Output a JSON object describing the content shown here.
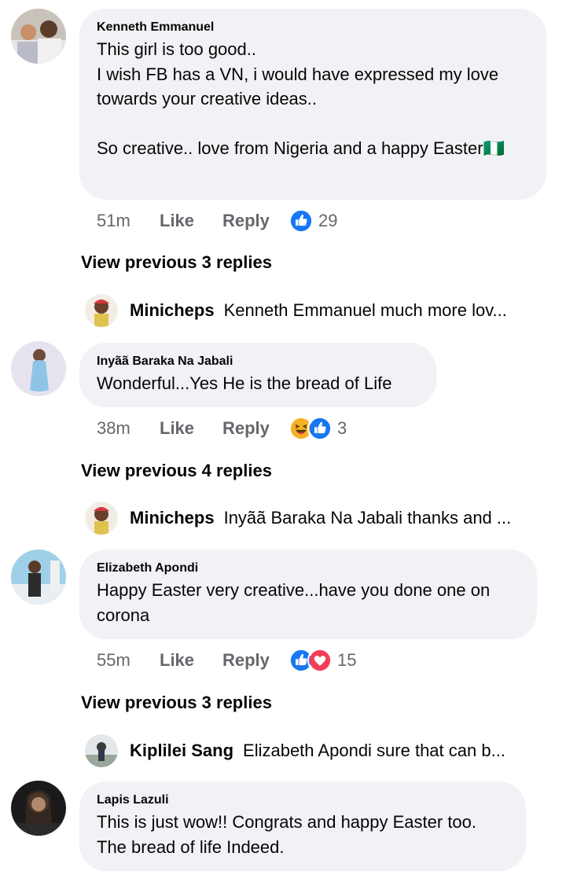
{
  "comments": [
    {
      "author": "Kenneth Emmanuel",
      "text": "This girl is too good..\nI wish FB has a VN, i would have expressed my love towards your creative ideas..\n\nSo creative.. love from Nigeria and a happy Easter🇳🇬",
      "time": "51m",
      "like_label": "Like",
      "reply_label": "Reply",
      "reactions": [
        "like-icon"
      ],
      "reaction_count": "29",
      "view_previous": "View previous 3 replies",
      "latest_reply": {
        "author": "Minicheps",
        "text": "Kenneth Emmanuel much more lov..."
      }
    },
    {
      "author": "Inyãã Baraka Na Jabali",
      "text": "Wonderful...Yes He is the bread of Life",
      "time": "38m",
      "like_label": "Like",
      "reply_label": "Reply",
      "reactions": [
        "haha-icon",
        "like-icon"
      ],
      "reaction_count": "3",
      "view_previous": "View previous 4 replies",
      "latest_reply": {
        "author": "Minicheps",
        "text": "Inyãã Baraka Na Jabali thanks and ..."
      }
    },
    {
      "author": "Elizabeth Apondi",
      "text": "Happy Easter very creative...have you done one on corona",
      "time": "55m",
      "like_label": "Like",
      "reply_label": "Reply",
      "reactions": [
        "like-icon",
        "love-icon"
      ],
      "reaction_count": "15",
      "view_previous": "View previous 3 replies",
      "latest_reply": {
        "author": "Kiplilei Sang",
        "text": "Elizabeth Apondi  sure that can b..."
      }
    },
    {
      "author": "Lapis Lazuli",
      "text": "This is just wow!! Congrats and happy Easter too. The bread of life Indeed."
    }
  ],
  "colors": {
    "bubble": "#f0f2f5",
    "meta_text": "#65676b",
    "like_blue": "#1877f2",
    "love_red": "#f33e58",
    "haha_yellow": "#f7b125"
  }
}
